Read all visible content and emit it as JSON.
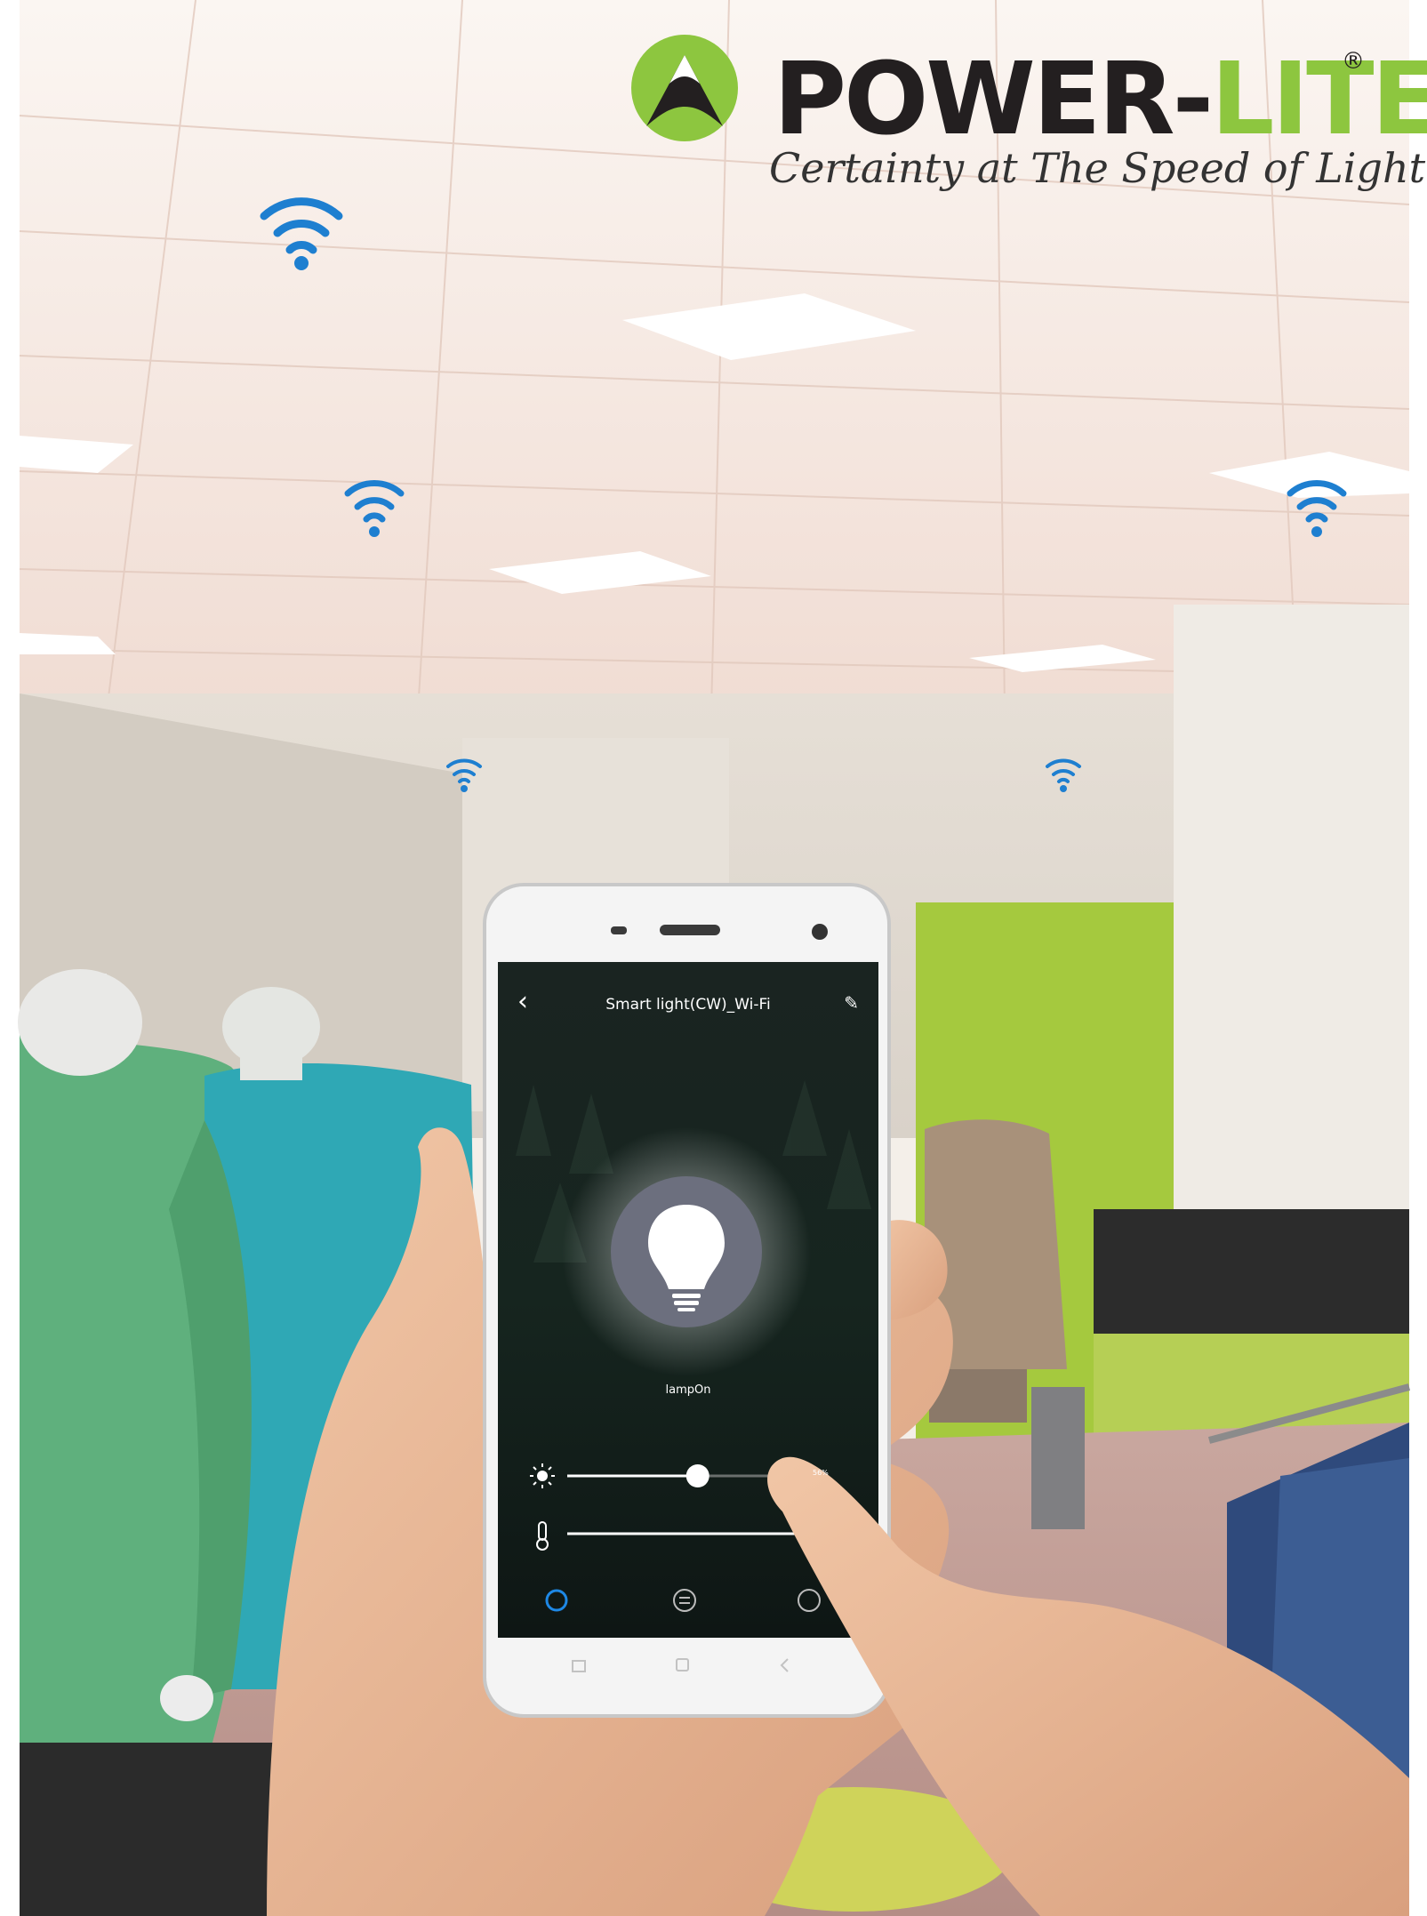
{
  "brand": {
    "name_dark": "POWER-",
    "name_green": "LITE",
    "registered": "®",
    "tagline": "Certainty at The Speed of Light",
    "colors": {
      "green": "#8dc63f",
      "dark": "#231f20"
    }
  },
  "app": {
    "title": "Smart light(CW)_Wi-Fi",
    "back_icon": "chevron-left-icon",
    "edit_icon": "pencil-icon",
    "lamp_status": "lampOn",
    "brightness_icon": "sun-icon",
    "brightness_value": "56%",
    "brightness_level": 0.56,
    "temperature_icon": "thermometer-icon",
    "bottom_tabs": [
      "power-tab-icon",
      "scene-tab-icon",
      "timer-tab-icon"
    ],
    "accent": "#1e88e5"
  },
  "phone_nav": {
    "icons": [
      "menu-icon",
      "home-icon",
      "back-icon"
    ]
  },
  "wifi_icon_color": "#1e7fd0"
}
